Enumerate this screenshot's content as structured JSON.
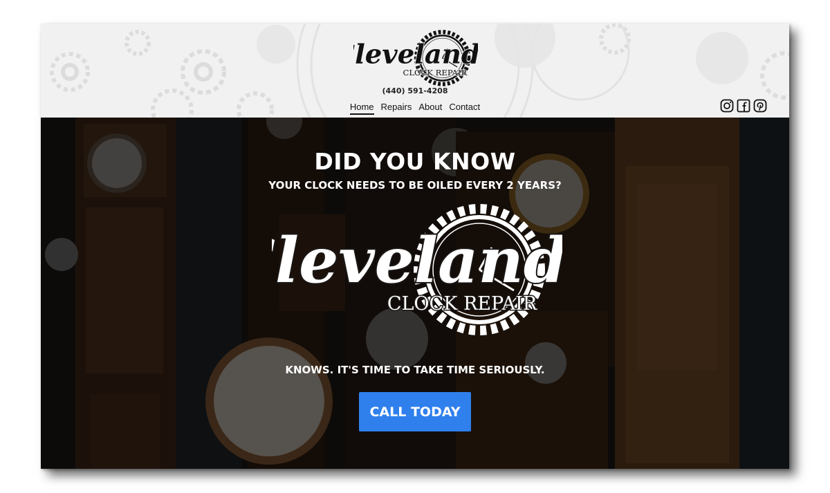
{
  "header": {
    "logo": {
      "script": "Cleveland",
      "subtitle": "CLOCK REPAIR"
    },
    "phone": "(440) 591-4208",
    "nav": [
      {
        "label": "Home",
        "active": true
      },
      {
        "label": "Repairs",
        "active": false
      },
      {
        "label": "About",
        "active": false
      },
      {
        "label": "Contact",
        "active": false
      }
    ],
    "social": [
      {
        "name": "instagram-icon"
      },
      {
        "name": "facebook-icon"
      },
      {
        "name": "pinterest-icon"
      }
    ]
  },
  "hero": {
    "title": "DID YOU KNOW",
    "subtitle": "YOUR CLOCK NEEDS TO BE OILED EVERY 2 YEARS?",
    "logo": {
      "script": "Cleveland",
      "subtitle": "CLOCK REPAIR"
    },
    "tagline": "KNOWS. IT'S TIME TO TAKE TIME SERIOUSLY.",
    "cta_label": "CALL TODAY"
  },
  "colors": {
    "cta": "#2f80ed",
    "header_bg": "#f1f1f1",
    "hero_text": "#ffffff",
    "hero_bg": "#1a1715"
  }
}
